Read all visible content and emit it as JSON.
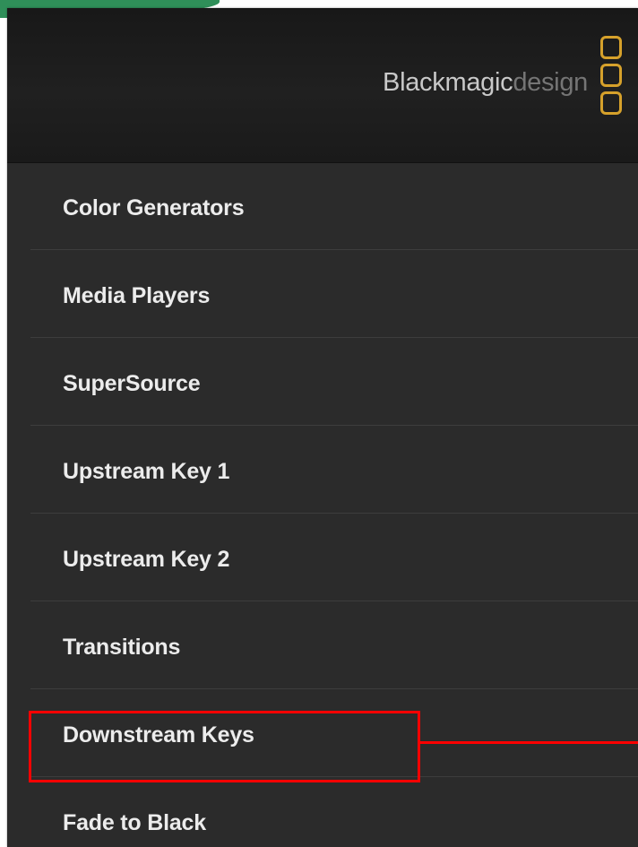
{
  "brand": {
    "name_main": "Blackmagic",
    "name_sub": "design",
    "logo_icon": "blackmagic-three-squares-logo",
    "logo_color": "#d6a12b"
  },
  "menu": {
    "items": [
      {
        "label": "Color Generators"
      },
      {
        "label": "Media Players"
      },
      {
        "label": "SuperSource"
      },
      {
        "label": "Upstream Key 1"
      },
      {
        "label": "Upstream Key 2"
      },
      {
        "label": "Transitions"
      },
      {
        "label": "Downstream Keys"
      },
      {
        "label": "Fade to Black"
      }
    ]
  },
  "annotation": {
    "highlighted_item": "Downstream Keys",
    "color": "#ff0000"
  },
  "colors": {
    "panel_background": "#2b2b2b",
    "header_background": "#1c1c1c",
    "accent_green": "#2f8f59",
    "menu_text": "#ececec"
  }
}
